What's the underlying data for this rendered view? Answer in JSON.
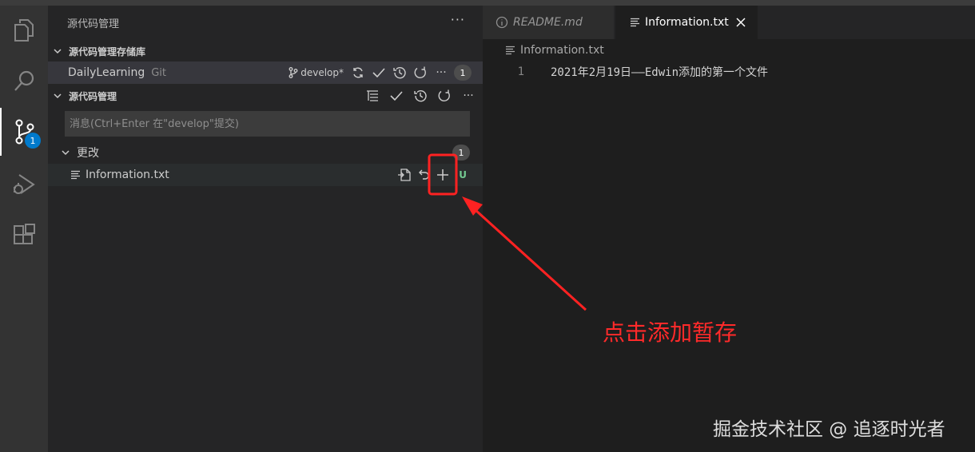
{
  "sidebar": {
    "title": "源代码管理",
    "more_icon": "ellipsis-icon",
    "repositories_section": {
      "label": "源代码管理存储库",
      "repo": {
        "name": "DailyLearning",
        "type": "Git",
        "branch": "develop*",
        "badge_count": "1"
      }
    },
    "scm_section": {
      "label": "源代码管理",
      "message_placeholder": "消息(Ctrl+Enter 在\"develop\"提交)"
    },
    "changes": {
      "label": "更改",
      "count": "1",
      "files": [
        {
          "name": "Information.txt",
          "status": "U"
        }
      ]
    }
  },
  "activity_bar": {
    "items": [
      {
        "name": "explorer",
        "icon": "files-icon"
      },
      {
        "name": "search",
        "icon": "search-icon"
      },
      {
        "name": "source-control",
        "icon": "source-control-icon",
        "badge": "1",
        "active": true
      },
      {
        "name": "run-debug",
        "icon": "run-debug-icon"
      },
      {
        "name": "extensions",
        "icon": "extensions-icon"
      }
    ]
  },
  "editor": {
    "tabs": [
      {
        "label": "README.md",
        "icon": "info-icon",
        "active": false
      },
      {
        "label": "Information.txt",
        "icon": "file-lines-icon",
        "active": true
      }
    ],
    "breadcrumb": "Information.txt",
    "lines": [
      {
        "number": "1",
        "text": "2021年2月19日——Edwin添加的第一个文件"
      }
    ]
  },
  "annotation": {
    "label": "点击添加暂存",
    "color": "#ff2a2a"
  },
  "watermark": "掘金技术社区 @ 追逐时光者",
  "colors": {
    "accent": "#007acc",
    "untracked": "#73c991"
  }
}
